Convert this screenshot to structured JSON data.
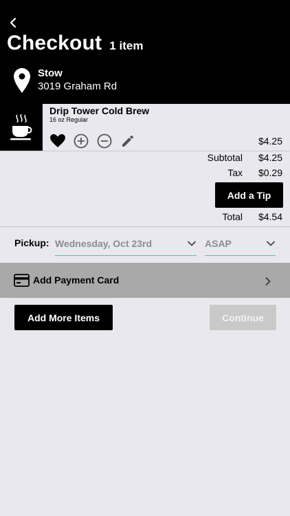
{
  "header": {
    "title": "Checkout",
    "item_count": "1 item",
    "store_name": "Stow",
    "store_address": "3019 Graham Rd"
  },
  "cart": {
    "items": [
      {
        "name": "Drip Tower Cold Brew",
        "variant": "16 oz Regular",
        "price": "$4.25",
        "icon": "coffee-cup-icon"
      }
    ]
  },
  "summary": {
    "subtotal_label": "Subtotal",
    "subtotal_value": "$4.25",
    "tax_label": "Tax",
    "tax_value": "$0.29",
    "tip_button": "Add a Tip",
    "total_label": "Total",
    "total_value": "$4.54"
  },
  "pickup": {
    "label": "Pickup:",
    "date_selected": "Wednesday, Oct 23rd",
    "time_selected": "ASAP"
  },
  "payment": {
    "label": "Add Payment Card"
  },
  "actions": {
    "add_more": "Add More Items",
    "continue": "Continue"
  },
  "colors": {
    "header_bg": "#000000",
    "page_bg": "#e9e8ef",
    "accent_underline": "#44c2b6",
    "payment_row_bg": "#a9a9a9",
    "disabled_button": "#c9c9c9"
  }
}
